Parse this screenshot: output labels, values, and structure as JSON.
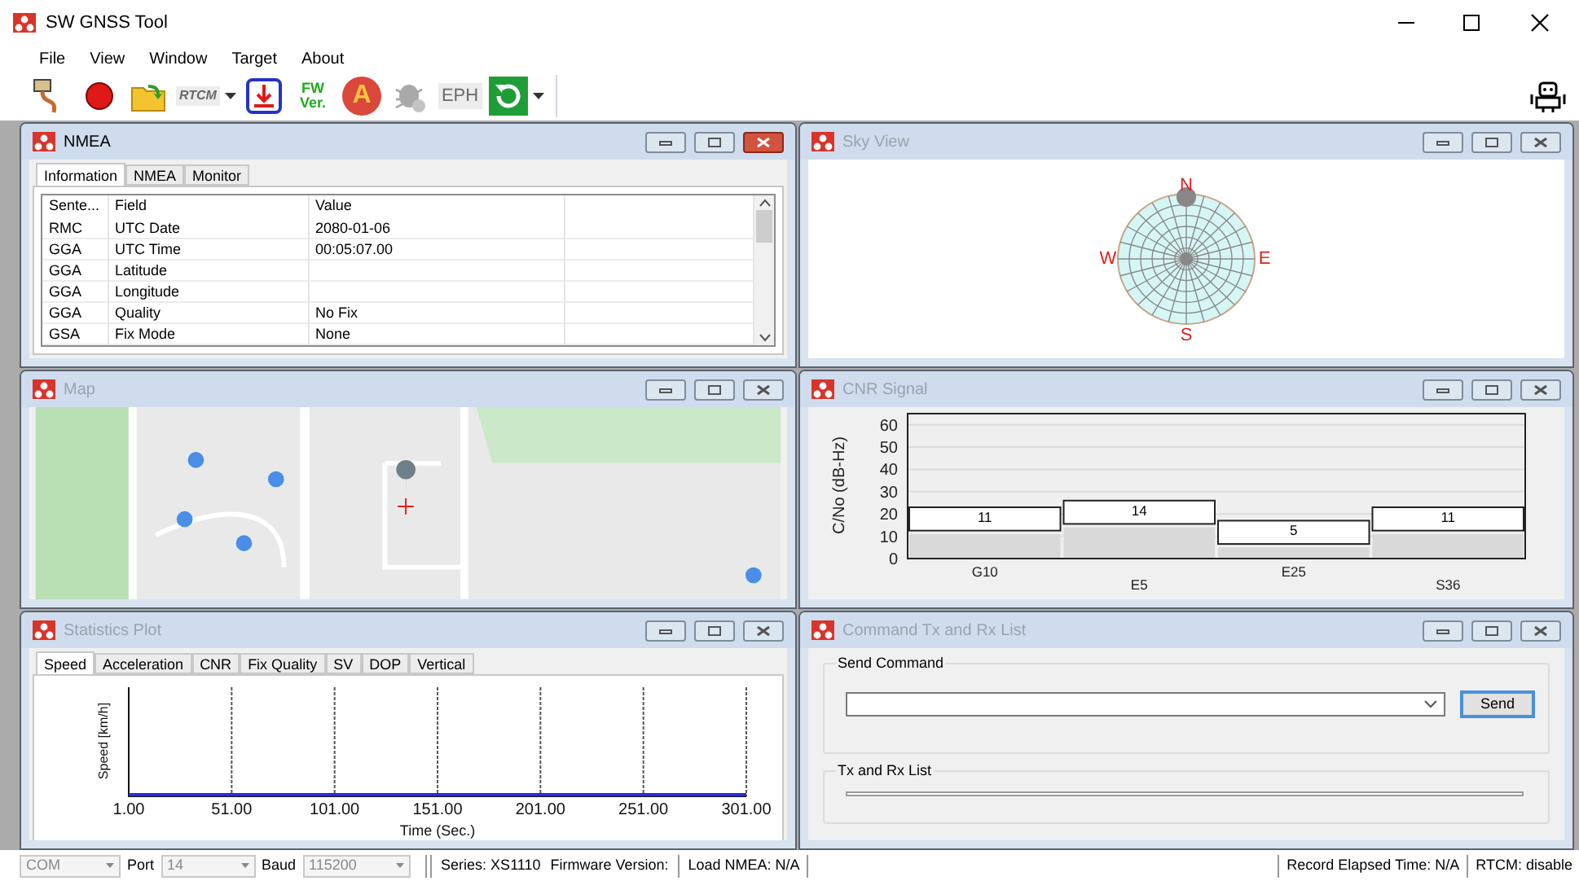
{
  "window": {
    "title": "SW GNSS Tool"
  },
  "menu": [
    "File",
    "View",
    "Window",
    "Target",
    "About"
  ],
  "toolbar": [
    {
      "kind": "cable",
      "disabled": false,
      "dropdown": false
    },
    {
      "kind": "record",
      "disabled": false,
      "dropdown": false
    },
    {
      "kind": "folder",
      "disabled": false,
      "dropdown": false
    },
    {
      "kind": "rtcm",
      "label": "RTCM",
      "disabled": true,
      "dropdown": true
    },
    {
      "kind": "download",
      "disabled": false,
      "dropdown": false
    },
    {
      "kind": "fw",
      "label": "FW Ver.",
      "disabled": false,
      "dropdown": false
    },
    {
      "kind": "letter",
      "label": "A",
      "disabled": false,
      "dropdown": false
    },
    {
      "kind": "bug",
      "disabled": true,
      "dropdown": false
    },
    {
      "kind": "eph",
      "label": "EPH",
      "disabled": true,
      "dropdown": false
    },
    {
      "kind": "refresh",
      "disabled": false,
      "dropdown": true
    }
  ],
  "nmea_panel": {
    "title": "NMEA",
    "active": true,
    "tabs": [
      {
        "label": "Information",
        "selected": true
      },
      {
        "label": "NMEA",
        "selected": false
      },
      {
        "label": "Monitor",
        "selected": false
      }
    ],
    "columns": [
      "Sente...",
      "Field",
      "Value"
    ],
    "rows": [
      [
        "RMC",
        "UTC Date",
        "2080-01-06"
      ],
      [
        "GGA",
        "UTC Time",
        "00:05:07.00"
      ],
      [
        "GGA",
        "Latitude",
        ""
      ],
      [
        "GGA",
        "Longitude",
        ""
      ],
      [
        "GGA",
        "Quality",
        "No Fix"
      ],
      [
        "GSA",
        "Fix Mode",
        "None"
      ]
    ]
  },
  "sky_view_panel": {
    "title": "Sky View",
    "active": false,
    "compass": [
      "N",
      "E",
      "S",
      "W"
    ]
  },
  "map_panel": {
    "title": "Map",
    "active": false
  },
  "cnr_panel": {
    "title": "CNR Signal",
    "active": false,
    "chart_data": {
      "type": "bar",
      "ylabel": "C/No (dB-Hz)",
      "categories": [
        "G10",
        "E5",
        "E25",
        "S36"
      ],
      "values": [
        11,
        14,
        5,
        11
      ],
      "ylim": [
        0,
        65
      ],
      "yticks": [
        0,
        10,
        20,
        30,
        40,
        50,
        60
      ],
      "grid": true,
      "data_labels": true
    }
  },
  "stats_panel": {
    "title": "Statistics Plot",
    "active": false,
    "tabs": [
      {
        "label": "Speed",
        "selected": true
      },
      {
        "label": "Acceleration",
        "selected": false
      },
      {
        "label": "CNR",
        "selected": false
      },
      {
        "label": "Fix Quality",
        "selected": false
      },
      {
        "label": "SV",
        "selected": false
      },
      {
        "label": "DOP",
        "selected": false
      },
      {
        "label": "Vertical",
        "selected": false
      }
    ],
    "ylabel": "Speed [km/h]",
    "xlabel": "Time (Sec.)",
    "x_tick_labels": [
      "1.00",
      "51.00",
      "101.00",
      "151.00",
      "201.00",
      "251.00",
      "301.00"
    ]
  },
  "command_panel": {
    "title": "Command Tx and Rx List",
    "active": false,
    "send_group": "Send Command",
    "send_button": "Send",
    "list_group": "Tx and Rx List"
  },
  "status_bar": {
    "connection": {
      "value": "COM",
      "disabled": true
    },
    "port_label": "Port",
    "port": {
      "value": "14",
      "disabled": true
    },
    "baud_label": "Baud",
    "baud": {
      "value": "115200",
      "disabled": true
    },
    "series": "Series: XS1110",
    "firmware": "Firmware Version:",
    "load_nmea": "Load NMEA: N/A",
    "record_time": "Record Elapsed Time: N/A",
    "rtcm": "RTCM: disable"
  }
}
